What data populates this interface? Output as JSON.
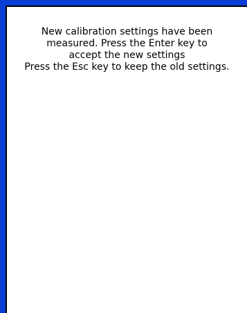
{
  "dialog": {
    "lines": [
      "New calibration settings have been",
      "measured. Press the Enter key to",
      "accept the new settings",
      "Press the Esc key to keep the old settings."
    ]
  },
  "colors": {
    "frame_blue": "#0a3fd6",
    "background": "#ffffff",
    "text": "#000000"
  }
}
